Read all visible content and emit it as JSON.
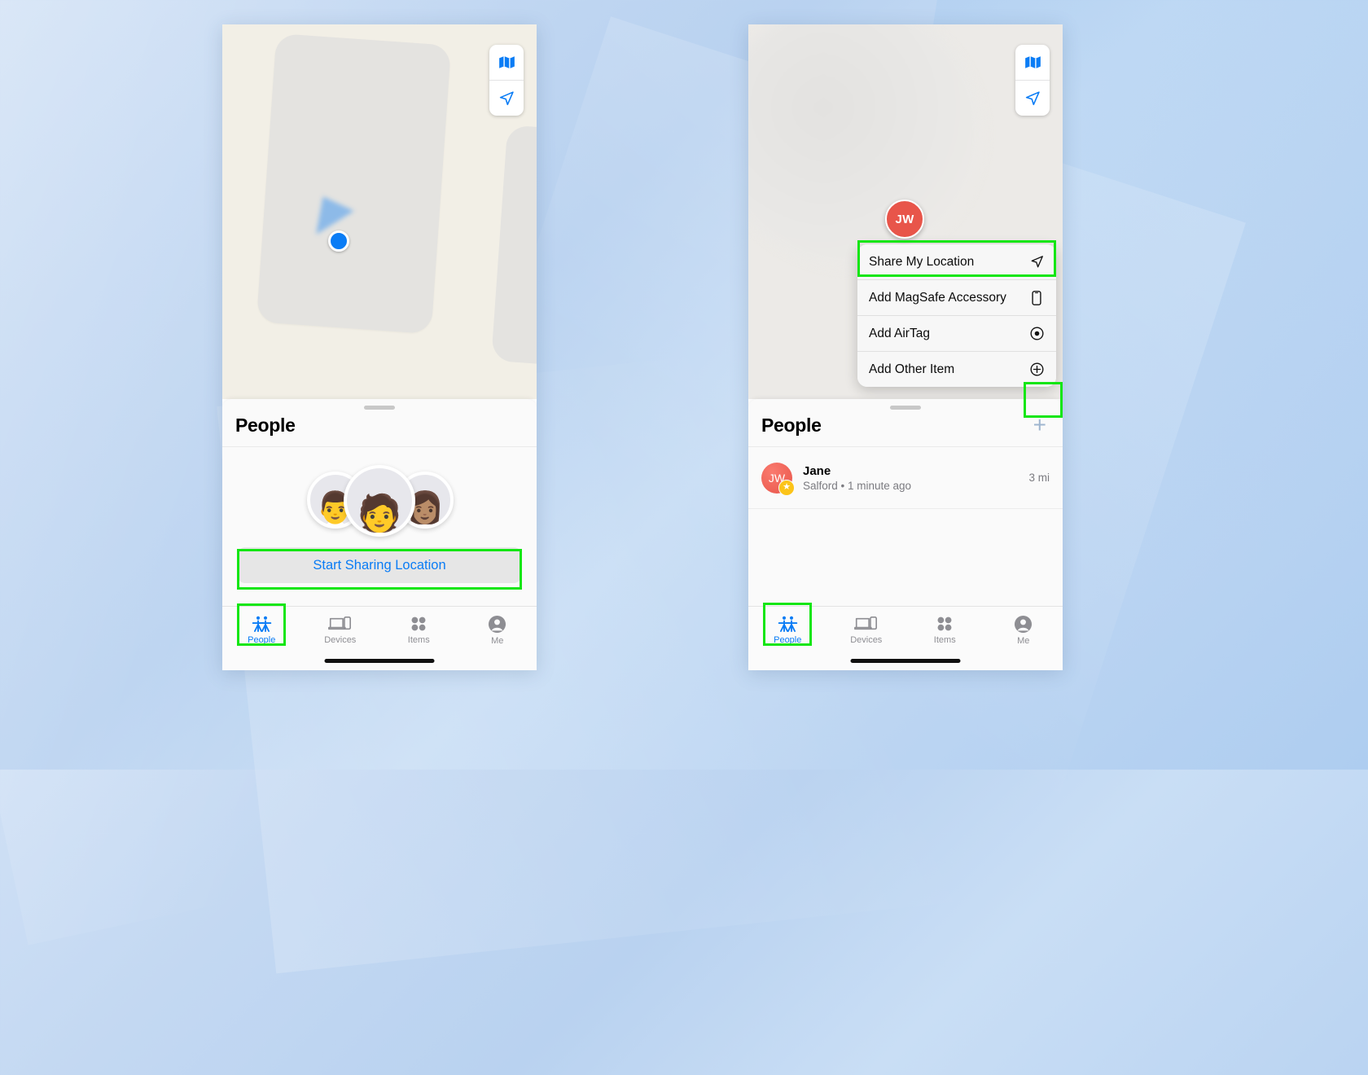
{
  "app": {
    "name": "Find My",
    "platform": "iOS"
  },
  "background": {
    "accent": "#bcd5f2"
  },
  "highlight_color": "#13e613",
  "left_phone": {
    "name": "find-my-people-empty-state",
    "map": {
      "controls": [
        {
          "name": "map-type-button",
          "icon": "map-icon"
        },
        {
          "name": "locate-me-button",
          "icon": "navigation-arrow-icon"
        }
      ],
      "user_location": "current-location-dot"
    },
    "sheet": {
      "title": "People",
      "memoji": [
        {
          "name": "memoji-left",
          "glyph": "👨"
        },
        {
          "name": "memoji-center",
          "glyph": "🧑"
        },
        {
          "name": "memoji-right",
          "glyph": "👩🏽"
        }
      ],
      "primary_button": "Start Sharing Location"
    },
    "tabs": [
      {
        "label": "People",
        "icon": "people-icon",
        "active": true
      },
      {
        "label": "Devices",
        "icon": "devices-icon",
        "active": false
      },
      {
        "label": "Items",
        "icon": "items-icon",
        "active": false
      },
      {
        "label": "Me",
        "icon": "me-icon",
        "active": false
      }
    ]
  },
  "right_phone": {
    "name": "find-my-people-add-menu",
    "map": {
      "controls": [
        {
          "name": "map-type-button",
          "icon": "map-icon"
        },
        {
          "name": "locate-me-button",
          "icon": "navigation-arrow-icon"
        }
      ],
      "pin_initials": "JW"
    },
    "menu": {
      "items": [
        {
          "label": "Share My Location",
          "icon": "navigation-arrow-icon",
          "highlighted": true
        },
        {
          "label": "Add MagSafe Accessory",
          "icon": "phone-icon",
          "highlighted": false
        },
        {
          "label": "Add AirTag",
          "icon": "airtag-icon",
          "highlighted": false
        },
        {
          "label": "Add Other Item",
          "icon": "plus-circle-icon",
          "highlighted": false
        }
      ]
    },
    "sheet": {
      "title": "People",
      "add_button": "+",
      "people": [
        {
          "initials": "JW",
          "name": "Jane",
          "subtitle": "Salford • 1 minute ago",
          "distance": "3 mi",
          "badge": "star"
        }
      ]
    },
    "tabs": [
      {
        "label": "People",
        "icon": "people-icon",
        "active": true
      },
      {
        "label": "Devices",
        "icon": "devices-icon",
        "active": false
      },
      {
        "label": "Items",
        "icon": "items-icon",
        "active": false
      },
      {
        "label": "Me",
        "icon": "me-icon",
        "active": false
      }
    ]
  }
}
